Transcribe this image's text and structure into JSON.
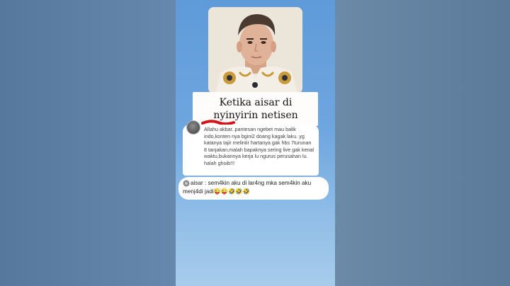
{
  "video": {
    "title_text": "Ketika aisar di nyinyirin netisen",
    "comment": {
      "text": "Allahu akbar..pantesan ngebet mau balik indo,konten nya bgini2 doang kagak laku. yg katanya tajir melintir hartanya gak hbs 7turunan 8 tanjakan,malah bapaknya sering live gak kenal waktu,bukannya kerja lu ngurus perusahan lu. halah ghoib!!!"
    },
    "reply": {
      "text": "aisar : sem4kin aku di lar4ng mka sem4kin aku menj4di jadi😜😜🤣🤣🤣"
    }
  },
  "colors": {
    "stage_top": "#5f9ad9",
    "stage_bottom": "#a7cceb",
    "side_panels": "#5b7c9f",
    "squiggle_red": "#d3161b",
    "card_bg": "#ffffff"
  },
  "icons": {
    "comment_avatar": "avatar-icon",
    "reply_icon": "speech-icon"
  }
}
